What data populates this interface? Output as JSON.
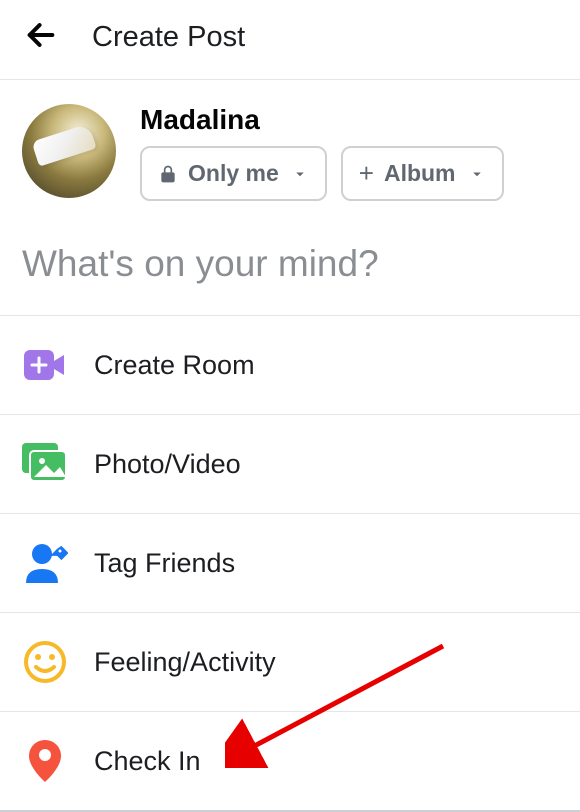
{
  "header": {
    "title": "Create Post"
  },
  "user": {
    "name": "Madalina",
    "privacy_label": "Only me",
    "album_label": "Album",
    "album_icon_text": "+"
  },
  "composer": {
    "placeholder": "What's on your mind?"
  },
  "menu": {
    "create_room": "Create Room",
    "photo_video": "Photo/Video",
    "tag_friends": "Tag Friends",
    "feeling_activity": "Feeling/Activity",
    "check_in": "Check In"
  },
  "colors": {
    "room_icon": "#a076e8",
    "photo_icon": "#45bd62",
    "tag_icon": "#1877f2",
    "feeling_icon": "#f7b928",
    "checkin_icon": "#f5533d",
    "annotation": "#e60000"
  }
}
